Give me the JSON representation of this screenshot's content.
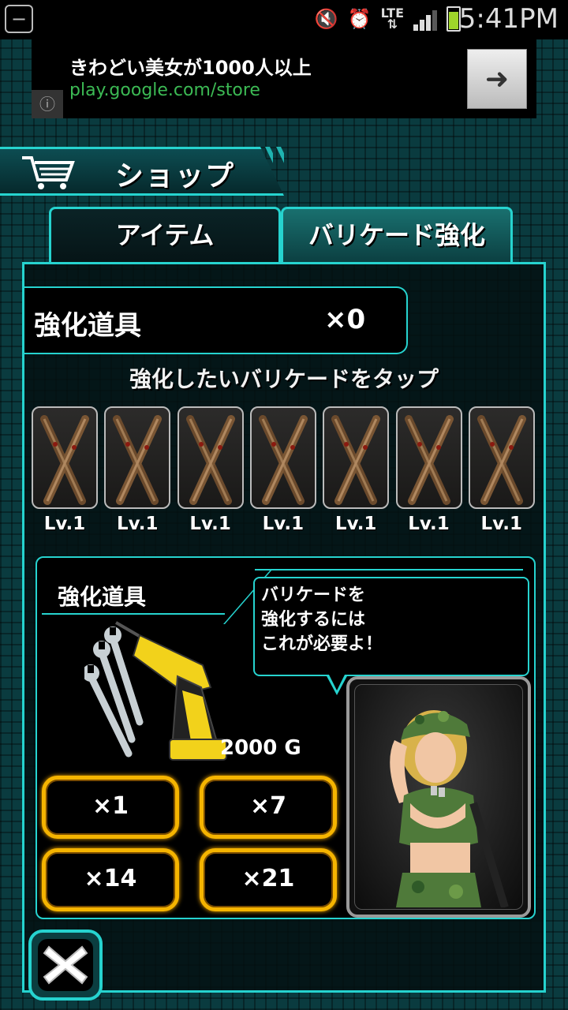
{
  "status_bar": {
    "time": "5:41PM",
    "network": "LTE",
    "battery_level": 0.78,
    "signal_level": 0.75,
    "icons": [
      "mute-icon",
      "alarm-icon",
      "lte-icon",
      "signal-icon",
      "battery-icon"
    ]
  },
  "ad": {
    "title": "きわどい美女が1000人以上",
    "url": "play.google.com/store",
    "info_icon": "info-icon",
    "arrow_icon": "arrow-right-icon"
  },
  "shop": {
    "title": "ショップ",
    "icon": "cart-icon"
  },
  "tabs": [
    {
      "label": "アイテム",
      "active": false
    },
    {
      "label": "バリケード強化",
      "active": true
    }
  ],
  "inventory": {
    "item_name": "強化道具",
    "count": "×0"
  },
  "hint": "強化したいバリケードをタップ",
  "barricades": [
    {
      "level": "Lv.1"
    },
    {
      "level": "Lv.1"
    },
    {
      "level": "Lv.1"
    },
    {
      "level": "Lv.1"
    },
    {
      "level": "Lv.1"
    },
    {
      "level": "Lv.1"
    },
    {
      "level": "Lv.1"
    }
  ],
  "detail": {
    "title": "強化道具",
    "speech": "バリケードを\n強化するには\nこれが必要よ！",
    "price": "2000 G",
    "buttons": [
      {
        "label": "×1"
      },
      {
        "label": "×7"
      },
      {
        "label": "×14"
      },
      {
        "label": "×21"
      }
    ]
  },
  "colors": {
    "accent": "#26d3cf",
    "button_border": "#f5b400",
    "ad_url": "#3cba54",
    "background": "#0a3b3f"
  }
}
